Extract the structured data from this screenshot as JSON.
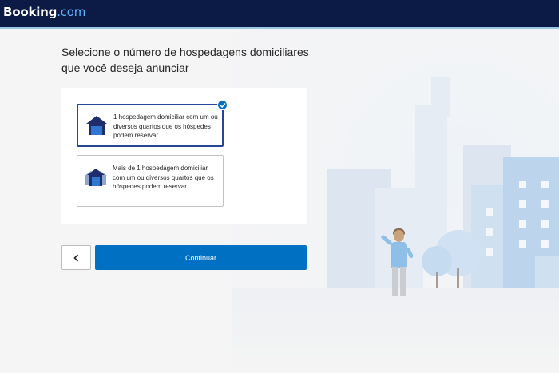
{
  "header": {
    "logo_main": "Booking",
    "logo_suffix": ".com"
  },
  "page": {
    "heading_line1": "Selecione o número de hospedagens domiciliares",
    "heading_line2": "que você deseja anunciar"
  },
  "options": [
    {
      "label": "1 hospedagem domiciliar com um ou diversos quartos que os hóspedes podem reservar",
      "selected": true,
      "icon": "single-house-icon"
    },
    {
      "label": "Mais de 1 hospedagem domiciliar com um ou diversos quartos que os hóspedes podem reservar",
      "selected": false,
      "icon": "multiple-houses-icon"
    }
  ],
  "actions": {
    "back_icon": "chevron-left-icon",
    "continue_label": "Continuar"
  },
  "colors": {
    "header_bg": "#0c1a46",
    "primary": "#0071c2",
    "selected_border": "#254799",
    "icon_dark": "#1f2e6b"
  }
}
